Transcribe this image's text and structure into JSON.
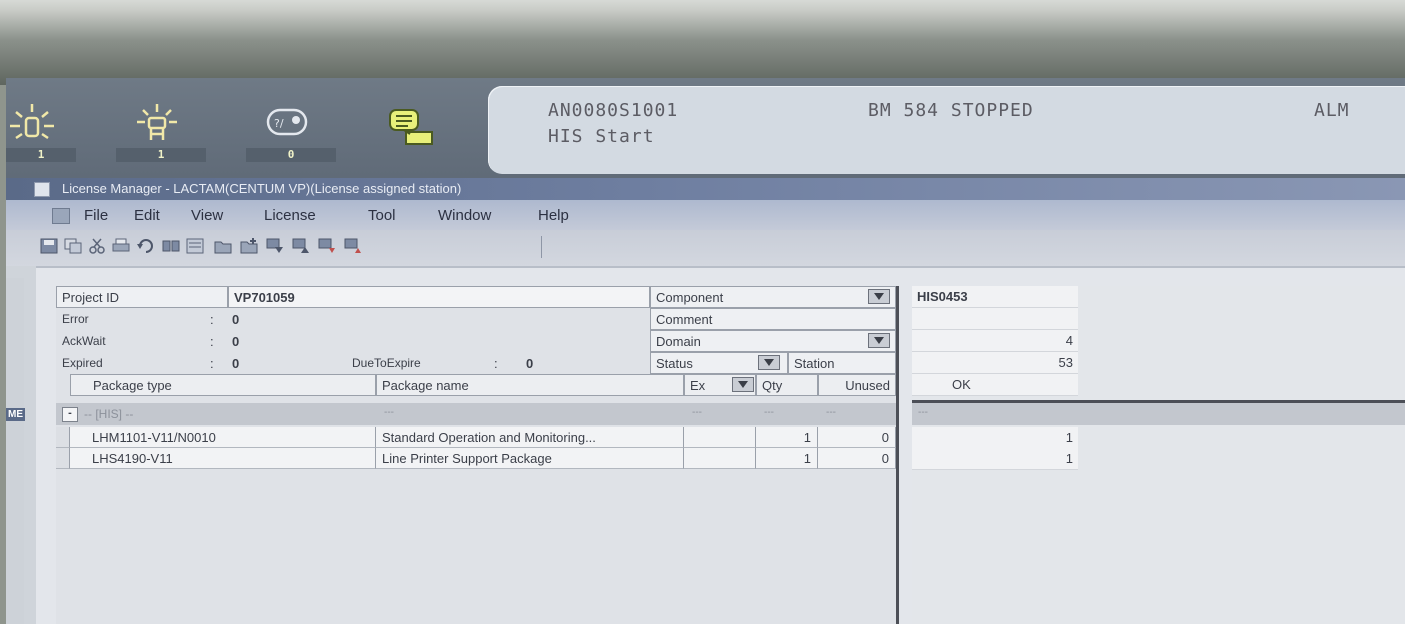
{
  "banner": {
    "counts": [
      "1",
      "1",
      "0"
    ],
    "message_line1_left": "AN0080S1001",
    "message_line1_right": "BM 584 STOPPED",
    "message_line1_tag": "ALM",
    "message_line2": "HIS Start"
  },
  "window": {
    "title": "License Manager - LACTAM(CENTUM VP)(License assigned station)"
  },
  "menu": [
    "File",
    "Edit",
    "View",
    "License",
    "Tool",
    "Window",
    "Help"
  ],
  "toolbar_icons": [
    "save-icon",
    "copy-icon",
    "cut-icon",
    "print-icon",
    "undo-icon",
    "find-icon",
    "list-icon",
    "folder-icon",
    "new-folder-icon",
    "assign-icon",
    "unassign-icon",
    "import-icon",
    "export-icon"
  ],
  "edge_label": "ME",
  "project": {
    "id_label": "Project ID",
    "id_value": "VP701059",
    "error_label": "Error",
    "error_value": "0",
    "ackwait_label": "AckWait",
    "ackwait_value": "0",
    "expired_label": "Expired",
    "expired_value": "0",
    "due_label": "DueToExpire",
    "due_value": "0",
    "colon": ":"
  },
  "filters": {
    "component": "Component",
    "comment": "Comment",
    "domain": "Domain",
    "status": "Status",
    "station": "Station"
  },
  "table": {
    "headers": {
      "package_type": "Package type",
      "package_name": "Package name",
      "ex": "Ex",
      "qty": "Qty",
      "unused": "Unused"
    },
    "group": {
      "toggle": "-",
      "label": "-- [HIS] --",
      "placeholder": "---"
    },
    "rows": [
      {
        "type": "LHM1101-V11/N0010",
        "name": "Standard Operation and Monitoring...",
        "qty": "1",
        "unused": "0"
      },
      {
        "type": "LHS4190-V11",
        "name": "Line Printer Support Package",
        "qty": "1",
        "unused": "0"
      }
    ]
  },
  "station": {
    "component": "HIS0453",
    "comment": "",
    "domain": "4",
    "station": "53",
    "status": "OK",
    "group_placeholder": "---",
    "row_values": [
      "1",
      "1"
    ]
  }
}
